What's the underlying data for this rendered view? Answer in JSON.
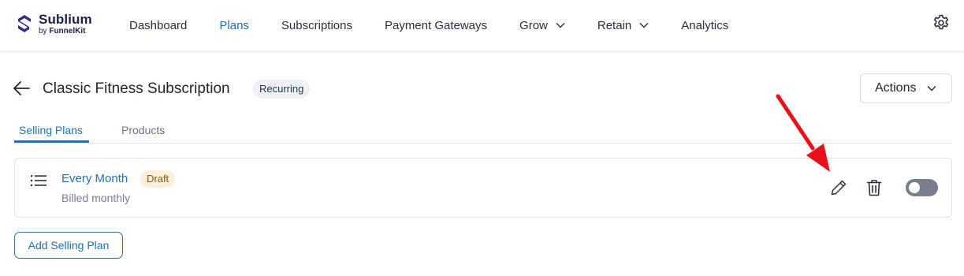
{
  "brand": {
    "name": "Sublium",
    "sub_prefix": "by ",
    "sub_brand": "FunnelKit",
    "logo_color": "#2b2f8f"
  },
  "nav": {
    "items": [
      {
        "label": "Dashboard",
        "active": false
      },
      {
        "label": "Plans",
        "active": true
      },
      {
        "label": "Subscriptions",
        "active": false
      },
      {
        "label": "Payment Gateways",
        "active": false
      },
      {
        "label": "Grow",
        "has_dropdown": true
      },
      {
        "label": "Retain",
        "has_dropdown": true
      },
      {
        "label": "Analytics",
        "active": false
      }
    ],
    "settings_icon": "gear-icon"
  },
  "page": {
    "title": "Classic Fitness Subscription",
    "type_badge": "Recurring",
    "actions_label": "Actions"
  },
  "tabs": [
    {
      "label": "Selling Plans",
      "active": true
    },
    {
      "label": "Products",
      "active": false
    }
  ],
  "plan": {
    "name": "Every Month",
    "status": "Draft",
    "description": "Billed monthly",
    "enabled": false
  },
  "add_button": "Add Selling Plan",
  "colors": {
    "accent": "#2271b1",
    "draft_bg": "#fbf0dc",
    "draft_text": "#8a5a14",
    "annotation": "#e8101a"
  }
}
